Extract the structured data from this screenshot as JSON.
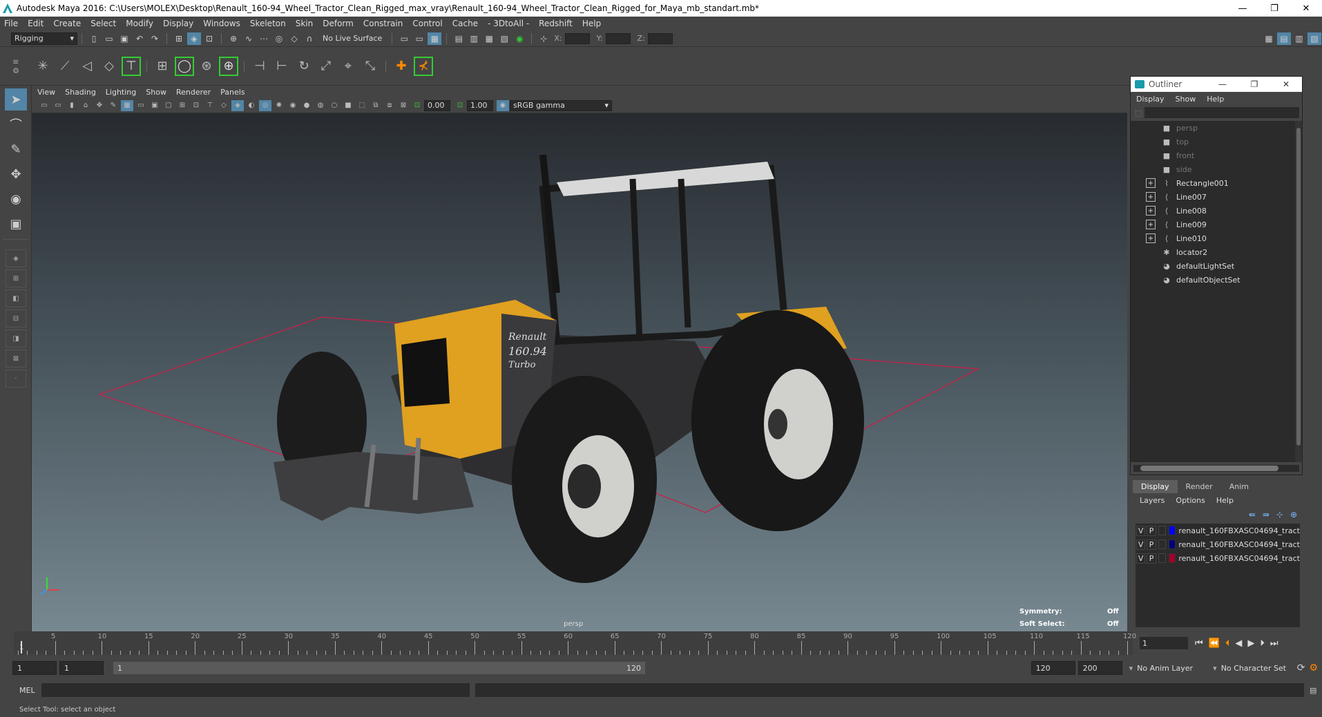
{
  "window": {
    "title": "Autodesk Maya 2016: C:\\Users\\MOLEX\\Desktop\\Renault_160-94_Wheel_Tractor_Clean_Rigged_max_vray\\Renault_160-94_Wheel_Tractor_Clean_Rigged_for_Maya_mb_standart.mb*",
    "minimize": "—",
    "restore": "❐",
    "close": "✕"
  },
  "menubar": [
    "File",
    "Edit",
    "Create",
    "Select",
    "Modify",
    "Display",
    "Windows",
    "Skeleton",
    "Skin",
    "Deform",
    "Constrain",
    "Control",
    "Cache",
    "- 3DtoAll -",
    "Redshift",
    "Help"
  ],
  "statusline": {
    "mode": "Rigging",
    "live_surface": "No Live Surface",
    "x_label": "X:",
    "y_label": "Y:",
    "z_label": "Z:"
  },
  "viewport": {
    "menu": [
      "View",
      "Shading",
      "Lighting",
      "Show",
      "Renderer",
      "Panels"
    ],
    "exposure": "0.00",
    "gamma_value": "1.00",
    "colorspace": "sRGB gamma",
    "camera_label": "persp",
    "hud": {
      "symmetry_label": "Symmetry:",
      "symmetry_value": "Off",
      "soft_select_label": "Soft Select:",
      "soft_select_value": "Off"
    },
    "model_text": {
      "brand": "Renault",
      "model": "160.94",
      "variant": "Turbo"
    }
  },
  "outliner": {
    "title": "Outliner",
    "menu": [
      "Display",
      "Show",
      "Help"
    ],
    "items": [
      {
        "label": "persp",
        "icon": "camera-icon",
        "expandable": false,
        "dim": true
      },
      {
        "label": "top",
        "icon": "camera-icon",
        "expandable": false,
        "dim": true
      },
      {
        "label": "front",
        "icon": "camera-icon",
        "expandable": false,
        "dim": true
      },
      {
        "label": "side",
        "icon": "camera-icon",
        "expandable": false,
        "dim": true
      },
      {
        "label": "Rectangle001",
        "icon": "curve-icon",
        "expandable": true,
        "dim": false
      },
      {
        "label": "Line007",
        "icon": "curve-icon",
        "expandable": true,
        "dim": false
      },
      {
        "label": "Line008",
        "icon": "curve-icon",
        "expandable": true,
        "dim": false
      },
      {
        "label": "Line009",
        "icon": "curve-icon",
        "expandable": true,
        "dim": false
      },
      {
        "label": "Line010",
        "icon": "curve-icon",
        "expandable": true,
        "dim": false
      },
      {
        "label": "locator2",
        "icon": "locator-icon",
        "expandable": false,
        "dim": false
      },
      {
        "label": "defaultLightSet",
        "icon": "set-icon",
        "expandable": false,
        "dim": false
      },
      {
        "label": "defaultObjectSet",
        "icon": "set-icon",
        "expandable": false,
        "dim": false
      }
    ]
  },
  "layers": {
    "tabs": [
      "Display",
      "Render",
      "Anim"
    ],
    "menu": [
      "Layers",
      "Options",
      "Help"
    ],
    "rows": [
      {
        "v": "V",
        "p": "P",
        "color": "#0000ff",
        "name": "renault_160FBXASC04694_tract"
      },
      {
        "v": "V",
        "p": "P",
        "color": "#00007a",
        "name": "renault_160FBXASC04694_tract"
      },
      {
        "v": "V",
        "p": "P",
        "color": "#a0002a",
        "name": "renault_160FBXASC04694_tract"
      }
    ]
  },
  "timeline": {
    "ticks": [
      5,
      10,
      15,
      20,
      25,
      30,
      35,
      40,
      45,
      50,
      55,
      60,
      65,
      70,
      75,
      80,
      85,
      90,
      95,
      100,
      105,
      110,
      115,
      120
    ],
    "start_label": "1",
    "current_frame": "1"
  },
  "range": {
    "start": "1",
    "playback_start": "1",
    "slider_start": "1",
    "slider_end": "120",
    "playback_end": "120",
    "end": "200",
    "anim_layer": "No Anim Layer",
    "character_set": "No Character Set"
  },
  "command": {
    "label": "MEL"
  },
  "status": {
    "help_text": "Select Tool: select an object"
  }
}
